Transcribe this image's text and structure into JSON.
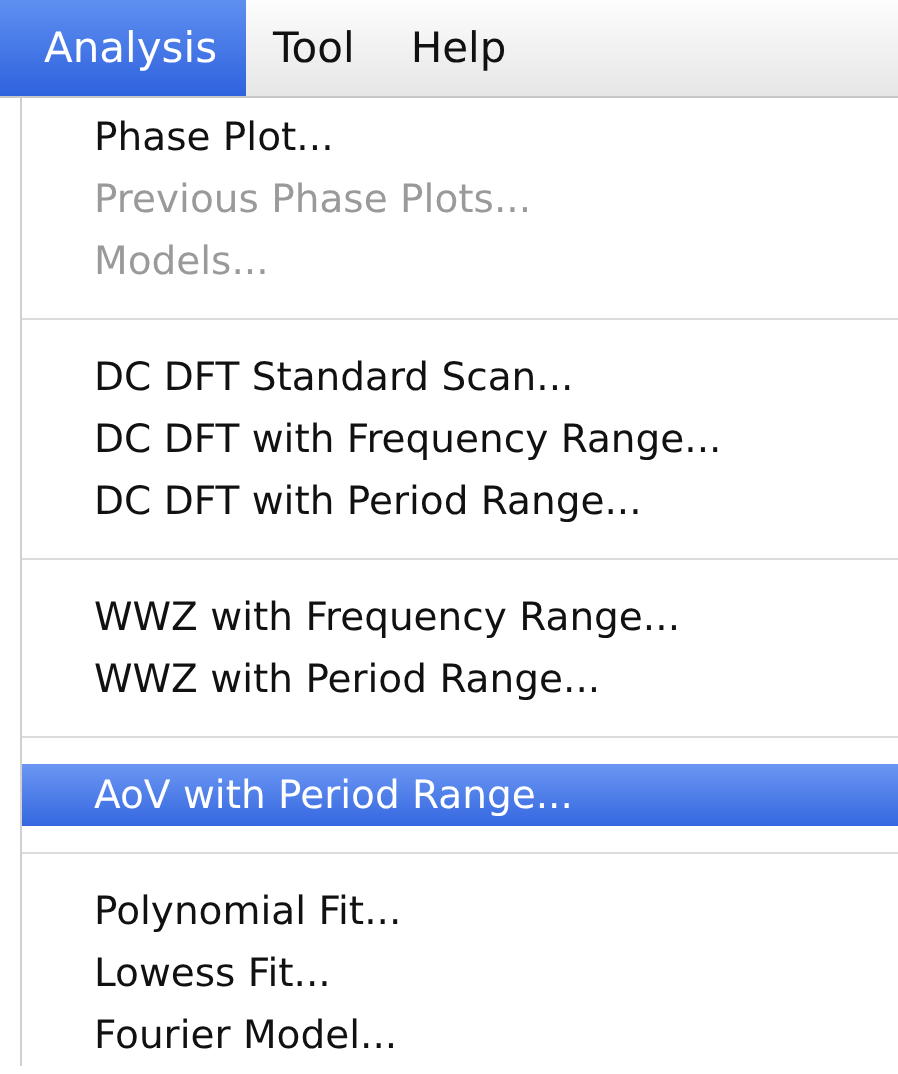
{
  "menubar": [
    {
      "label": "Analysis",
      "selected": true
    },
    {
      "label": "Tool",
      "selected": false
    },
    {
      "label": "Help",
      "selected": false
    }
  ],
  "menu": {
    "groups": [
      {
        "items": [
          {
            "label": "Phase Plot...",
            "disabled": false,
            "selected": false
          },
          {
            "label": "Previous Phase Plots...",
            "disabled": true,
            "selected": false
          },
          {
            "label": "Models...",
            "disabled": true,
            "selected": false
          }
        ]
      },
      {
        "items": [
          {
            "label": "DC DFT Standard Scan...",
            "disabled": false,
            "selected": false
          },
          {
            "label": "DC DFT with Frequency Range...",
            "disabled": false,
            "selected": false
          },
          {
            "label": "DC DFT with Period Range...",
            "disabled": false,
            "selected": false
          }
        ]
      },
      {
        "items": [
          {
            "label": "WWZ with Frequency Range...",
            "disabled": false,
            "selected": false
          },
          {
            "label": "WWZ with Period Range...",
            "disabled": false,
            "selected": false
          }
        ]
      },
      {
        "items": [
          {
            "label": "AoV with Period Range...",
            "disabled": false,
            "selected": true
          }
        ]
      },
      {
        "items": [
          {
            "label": "Polynomial Fit...",
            "disabled": false,
            "selected": false
          },
          {
            "label": "Lowess Fit...",
            "disabled": false,
            "selected": false
          },
          {
            "label": "Fourier Model...",
            "disabled": false,
            "selected": false
          }
        ]
      }
    ]
  }
}
